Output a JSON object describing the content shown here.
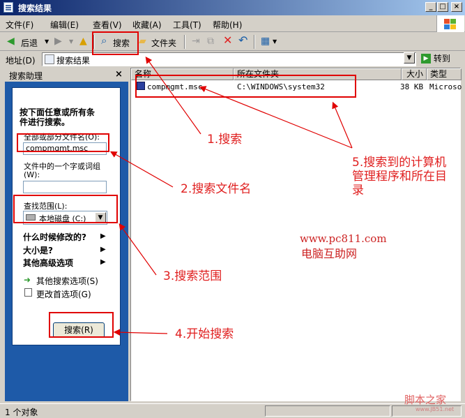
{
  "window": {
    "title": "搜索结果"
  },
  "menu": [
    "文件(F)",
    "编辑(E)",
    "查看(V)",
    "收藏(A)",
    "工具(T)",
    "帮助(H)"
  ],
  "toolbar": {
    "back": "后退",
    "search": "搜索",
    "folders": "文件夹"
  },
  "address": {
    "label": "地址(D)",
    "value": "搜索结果",
    "go": "转到"
  },
  "left_panel": {
    "title": "搜索助理",
    "close": "×",
    "intro": [
      "按下面任意或所有条",
      "件进行搜索。"
    ],
    "filename_label": "全部或部分文件名(O):",
    "filename_value": "compmgmt.msc",
    "word_label_1": "文件中的一个字或词组",
    "word_label_2": "(W):",
    "word_value": "",
    "scope_label": "查找范围(L):",
    "scope_value": "本地磁盘 (C:)",
    "options": [
      "什么时候修改的?",
      "大小是?",
      "其他高级选项"
    ],
    "links": [
      "其他搜索选项(S)",
      "更改首选项(G)"
    ],
    "search_button": "搜索(R)"
  },
  "results": {
    "columns": [
      "名称",
      "所在文件夹",
      "大小",
      "类型"
    ],
    "rows": [
      {
        "name": "compmgmt.msc",
        "folder": "C:\\WINDOWS\\system32",
        "size": "38 KB",
        "type": "Microso"
      }
    ]
  },
  "status": {
    "text": "1 个对象"
  },
  "annotations": {
    "a1": "1.搜索",
    "a2": "2.搜索文件名",
    "a3": "3.搜索范围",
    "a4": "4.开始搜索",
    "a5_line1": "5.搜索到的计算机",
    "a5_line2": "管理程序和所在目",
    "a5_line3": "录"
  },
  "watermarks": {
    "url": "www.pc811.com",
    "site": "电脑互助网",
    "site2": "脚本之家",
    "url2": "www.JB51.net"
  },
  "colors": {
    "annotation": "#e00000",
    "titlebar": "#0a246a",
    "panel": "#1e5aa8"
  }
}
